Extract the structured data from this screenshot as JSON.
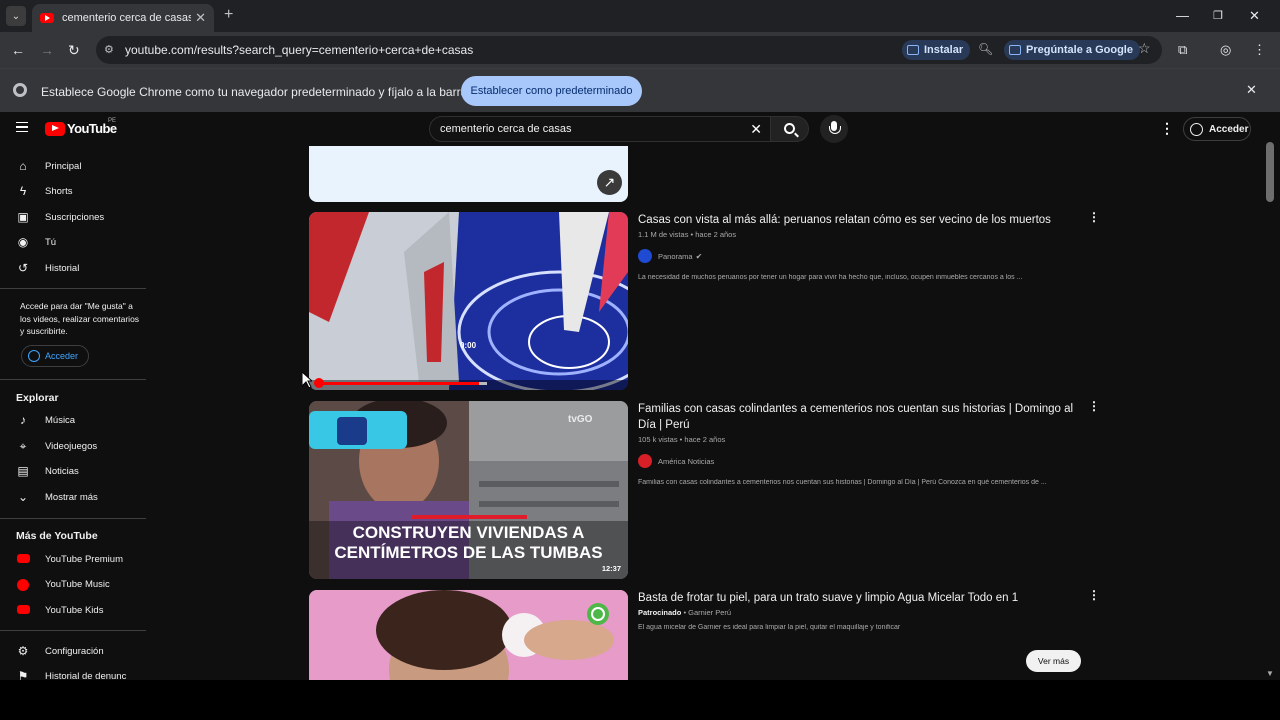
{
  "browser": {
    "tab_title": "cementerio cerca de casas - You",
    "url": "youtube.com/results?search_query=cementerio+cerca+de+casas",
    "install_label": "Instalar",
    "ask_google_label": "Pregúntale a Google",
    "infobar_message": "Establece Google Chrome como tu navegador predeterminado y fíjalo a la barra de tareas",
    "infobar_button": "Establecer como predeterminado"
  },
  "youtube": {
    "logo_text": "YouTube",
    "country_code": "PE",
    "search_query": "cementerio cerca de casas",
    "signin_label": "Acceder"
  },
  "sidebar": {
    "main": [
      {
        "label": "Principal",
        "icon": "home-icon"
      },
      {
        "label": "Shorts",
        "icon": "shorts-icon"
      },
      {
        "label": "Suscripciones",
        "icon": "subscriptions-icon"
      },
      {
        "label": "Tú",
        "icon": "you-icon"
      },
      {
        "label": "Historial",
        "icon": "history-icon"
      }
    ],
    "promo_text": "Accede para dar \"Me gusta\" a los videos, realizar comentarios y suscribirte.",
    "promo_button": "Acceder",
    "explore_heading": "Explorar",
    "explore": [
      {
        "label": "Música",
        "icon": "music-icon"
      },
      {
        "label": "Videojuegos",
        "icon": "gaming-icon"
      },
      {
        "label": "Noticias",
        "icon": "news-icon"
      },
      {
        "label": "Mostrar más",
        "icon": "chevron-down-icon"
      }
    ],
    "more_heading": "Más de YouTube",
    "more": [
      {
        "label": "YouTube Premium",
        "icon": "youtube-premium-icon"
      },
      {
        "label": "YouTube Music",
        "icon": "youtube-music-icon"
      },
      {
        "label": "YouTube Kids",
        "icon": "youtube-kids-icon"
      }
    ],
    "settings": [
      {
        "label": "Configuración",
        "icon": "gear-icon"
      },
      {
        "label": "Historial de denunc",
        "icon": "flag-icon"
      }
    ]
  },
  "results": [
    {
      "title": "Casas con vista al más allá: peruanos relatan cómo es ser vecino de los muertos",
      "meta": "1.1 M de vistas • hace 2 años",
      "channel": "Panorama",
      "description": "La necesidad de muchos peruanos por tener un hogar para vivir ha hecho que, incluso, ocupen inmuebles cercanos a los ...",
      "timestamp": "0:00"
    },
    {
      "title": "Familias con casas colindantes a cementerios nos cuentan sus historias | Domingo al Día | Perú",
      "meta": "105 k vistas • hace 2 años",
      "channel": "América Noticias",
      "description": "Familias con casas colindantes a cementerios nos cuentan sus historias | Domingo al Día | Perú Conozca en qué cementerios de ...",
      "overlay_line1": "CONSTRUYEN VIVIENDAS A",
      "overlay_line2": "CENTÍMETROS DE LAS TUMBAS",
      "duration": "12:37",
      "watermark": "tvGO"
    },
    {
      "title": "Basta de frotar tu piel, para un trato suave y limpio Agua Micelar Todo en 1",
      "sponsored": "Patrocinado",
      "channel": "Garnier Perú",
      "description": "El agua micelar de Garnier es ideal para limpiar la piel, quitar el maquillaje y tonificar",
      "cta": "Ver más"
    }
  ],
  "colors": {
    "yt_red": "#ff0000",
    "bg": "#0f0f0f",
    "chrome_blue": "#a8c7fa"
  }
}
